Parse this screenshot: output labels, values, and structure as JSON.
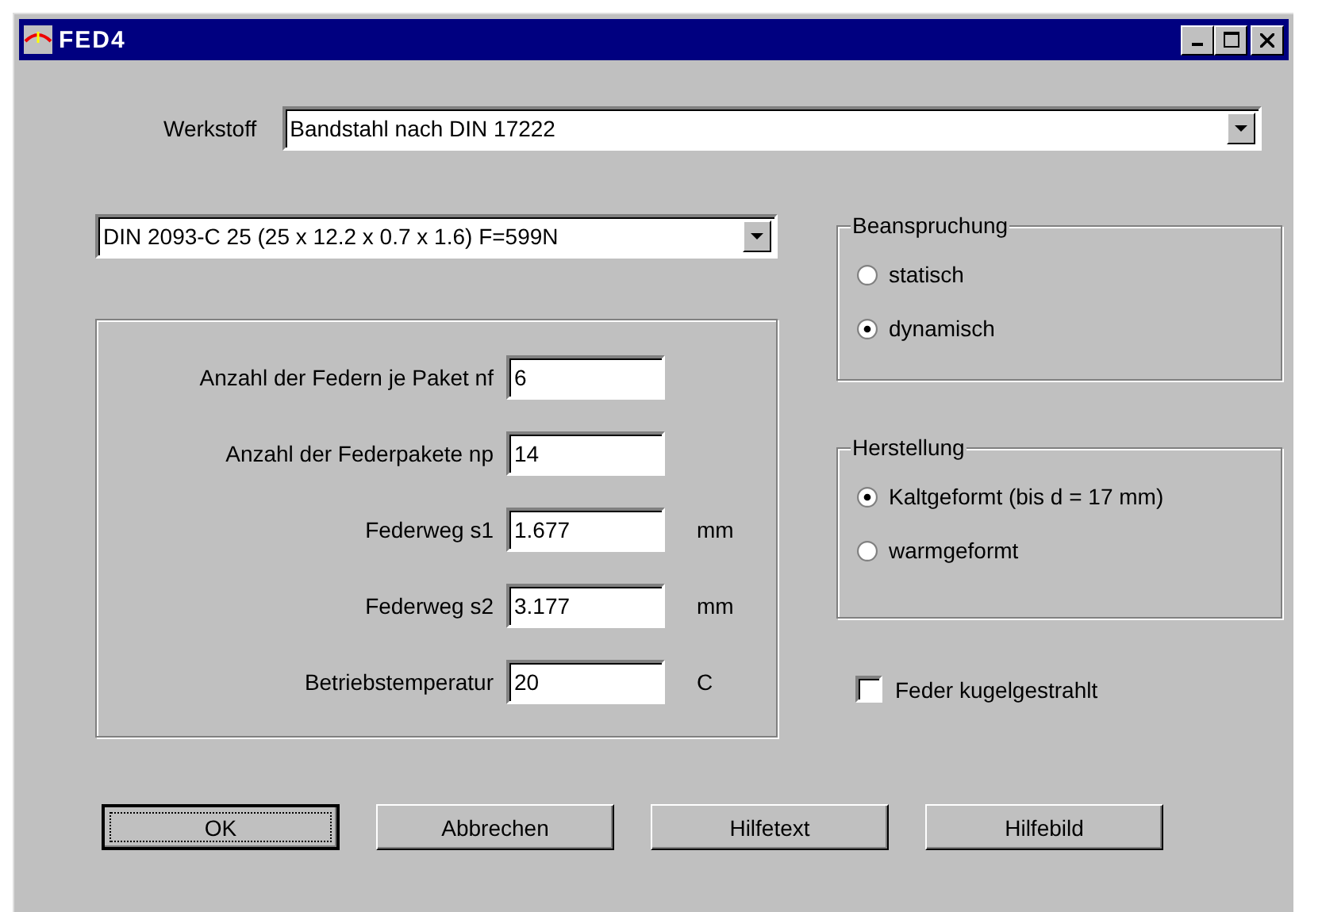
{
  "window": {
    "title": "FED4"
  },
  "material": {
    "label": "Werkstoff",
    "value": "Bandstahl nach DIN 17222"
  },
  "spring_type": {
    "value": "DIN 2093-C 25 (25 x 12.2 x 0.7 x 1.6)  F=599N"
  },
  "fields": [
    {
      "label": "Anzahl der Federn je Paket nf",
      "value": "6"
    },
    {
      "label": "Anzahl der Federpakete np",
      "value": "14"
    },
    {
      "label": "Federweg s1",
      "value": "1.677",
      "unit": "mm"
    },
    {
      "label": "Federweg s2",
      "value": "3.177",
      "unit": "mm"
    },
    {
      "label": "Betriebstemperatur",
      "value": "20",
      "unit": "C"
    }
  ],
  "groups": [
    {
      "title": "Beanspruchung",
      "options": [
        {
          "label": "statisch",
          "selected": false
        },
        {
          "label": "dynamisch",
          "selected": true
        }
      ]
    },
    {
      "title": "Herstellung",
      "options": [
        {
          "label": "Kaltgeformt (bis d = 17 mm)",
          "selected": true
        },
        {
          "label": "warmgeformt",
          "selected": false
        }
      ]
    }
  ],
  "checkbox": {
    "label": "Feder kugelgestrahlt",
    "checked": false
  },
  "buttons": [
    {
      "label": "OK",
      "default": true
    },
    {
      "label": "Abbrechen",
      "default": false
    },
    {
      "label": "Hilfetext",
      "default": false
    },
    {
      "label": "Hilfebild",
      "default": false
    }
  ]
}
